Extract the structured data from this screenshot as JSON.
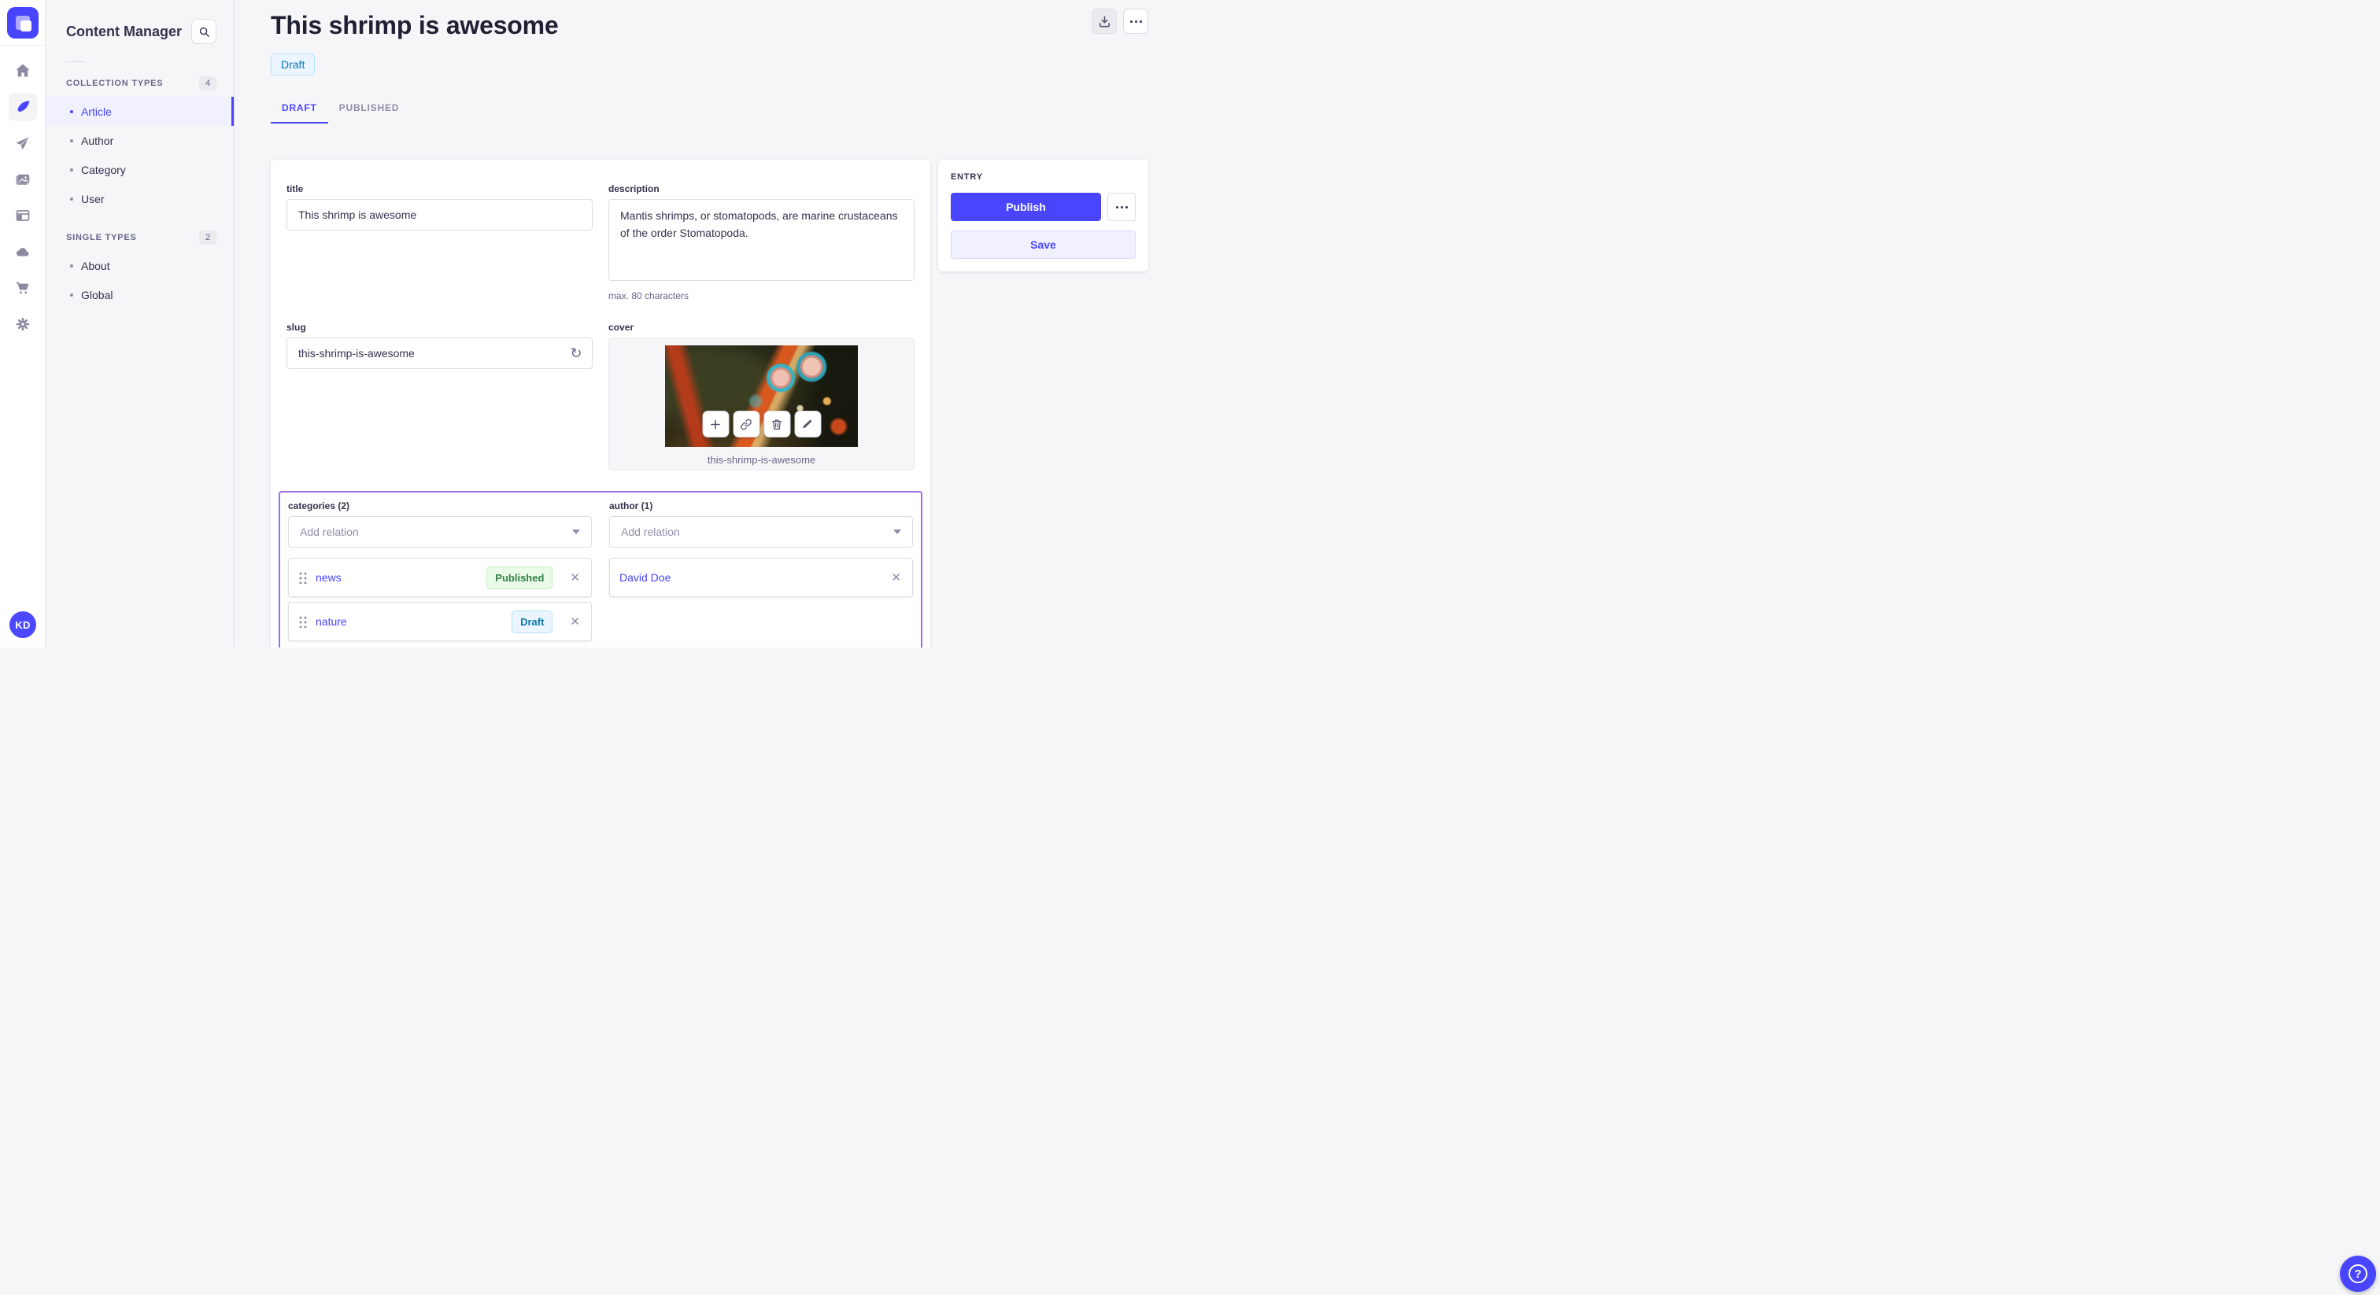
{
  "sidebar": {
    "app_title": "Content Manager",
    "avatar_initials": "KD",
    "collection_types": {
      "label": "COLLECTION TYPES",
      "count": "4",
      "items": [
        {
          "label": "Article",
          "active": true
        },
        {
          "label": "Author",
          "active": false
        },
        {
          "label": "Category",
          "active": false
        },
        {
          "label": "User",
          "active": false
        }
      ]
    },
    "single_types": {
      "label": "SINGLE TYPES",
      "count": "2",
      "items": [
        {
          "label": "About",
          "active": false
        },
        {
          "label": "Global",
          "active": false
        }
      ]
    }
  },
  "header": {
    "title": "This shrimp is awesome",
    "status_badge": "Draft",
    "tabs": [
      {
        "label": "DRAFT",
        "active": true
      },
      {
        "label": "PUBLISHED",
        "active": false
      }
    ]
  },
  "form": {
    "title_field": {
      "label": "title",
      "value": "This shrimp is awesome"
    },
    "description_field": {
      "label": "description",
      "value": "Mantis shrimps, or stomatopods, are marine crustaceans of the order Stomatopoda.",
      "hint": "max. 80 characters"
    },
    "slug_field": {
      "label": "slug",
      "value": "this-shrimp-is-awesome"
    },
    "cover_field": {
      "label": "cover",
      "caption": "this-shrimp-is-awesome"
    },
    "categories": {
      "label": "categories (2)",
      "placeholder": "Add relation",
      "items": [
        {
          "name": "news",
          "status": "Published"
        },
        {
          "name": "nature",
          "status": "Draft"
        }
      ]
    },
    "author": {
      "label": "author (1)",
      "placeholder": "Add relation",
      "items": [
        {
          "name": "David Doe"
        }
      ]
    }
  },
  "entry_panel": {
    "title": "ENTRY",
    "publish_label": "Publish",
    "save_label": "Save"
  },
  "icons": {
    "regenerate": "↻",
    "close": "✕",
    "help": "?"
  },
  "colors": {
    "accent": "#4945ff",
    "accent_light_bg": "#f0f0ff",
    "relations_outline": "#a26cf0",
    "draft_badge_bg": "#eaf5ff",
    "draft_badge_text": "#0c75af",
    "published_badge_bg": "#eafbe7",
    "published_badge_text": "#328048",
    "app_bg": "#f6f6f9"
  }
}
